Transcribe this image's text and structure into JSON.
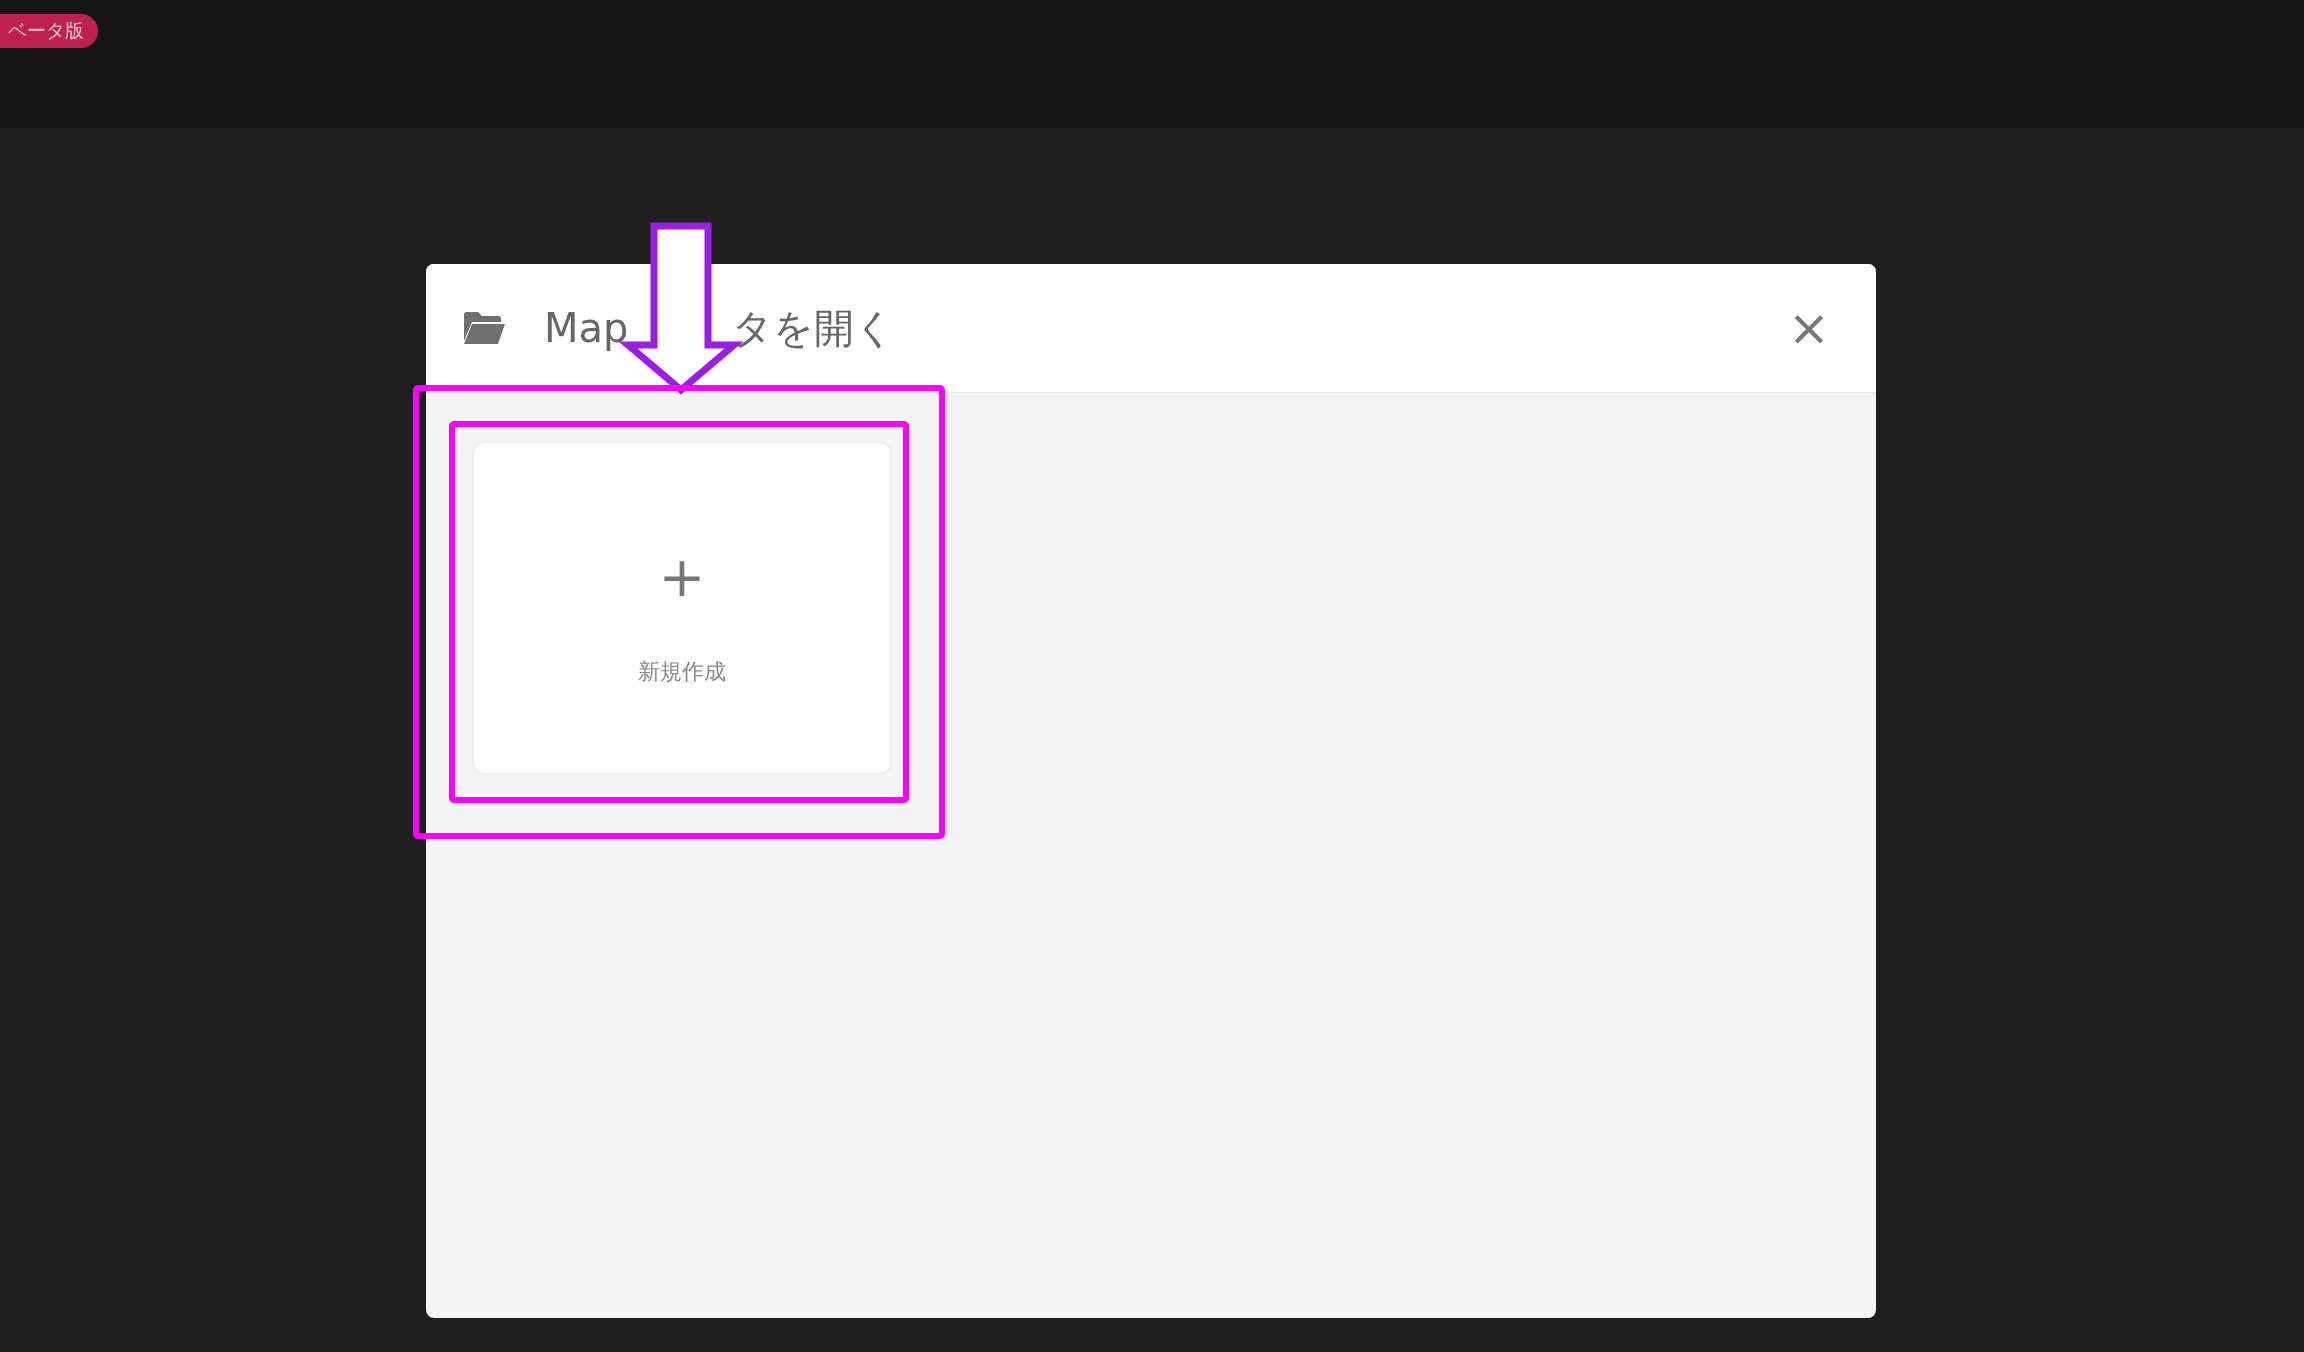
{
  "top_bar": {
    "badge": "ベータ版"
  },
  "dialog": {
    "title_parts": [
      "Map",
      "タを開く"
    ],
    "close": "×",
    "items": [
      {
        "kind": "new",
        "icon": "+",
        "label": "新規作成"
      }
    ]
  },
  "annotations": [
    {
      "kind": "arrow",
      "color": "#9b1de6"
    },
    {
      "kind": "frame",
      "color": "#ff00ff"
    },
    {
      "kind": "frame",
      "color": "#ff00ff"
    }
  ]
}
